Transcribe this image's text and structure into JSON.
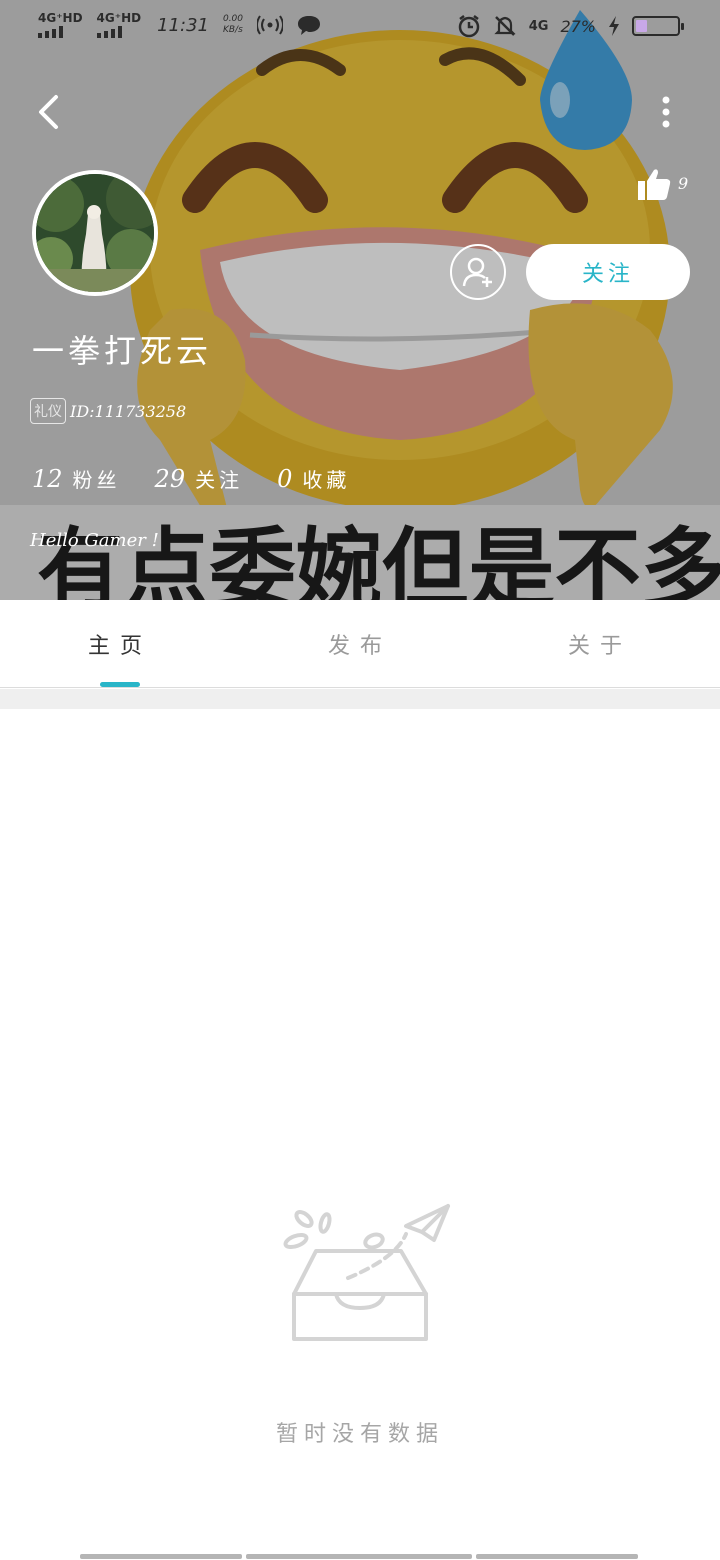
{
  "status_bar": {
    "network1": "4G⁺HD",
    "network2": "4G⁺HD",
    "time": "11:31",
    "speed_value": "0.00",
    "speed_unit": "KB/s",
    "network3": "4G",
    "battery_pct": "27%",
    "battery_level": 0.27,
    "icons": [
      "hotspot-icon",
      "message-bubble-icon",
      "alarm-icon",
      "mute-bell-icon",
      "charging-icon"
    ]
  },
  "header": {
    "banner_text": "有点委婉但是不多",
    "like_count": "9",
    "follow_label": "关注",
    "username": "一拳打死云",
    "badge": "礼仪",
    "user_id": "ID:111733258",
    "stats": [
      {
        "num": "12",
        "label": "粉丝"
      },
      {
        "num": "29",
        "label": "关注"
      },
      {
        "num": "0",
        "label": "收藏"
      }
    ],
    "bio": "Hello Gamer !"
  },
  "tabs": [
    {
      "label": "主页",
      "active": true
    },
    {
      "label": "发布",
      "active": false
    },
    {
      "label": "关于",
      "active": false
    }
  ],
  "empty_state": {
    "message": "暂时没有数据"
  },
  "colors": {
    "accent": "#29b5c8",
    "muted_text": "#a6a6a6"
  }
}
